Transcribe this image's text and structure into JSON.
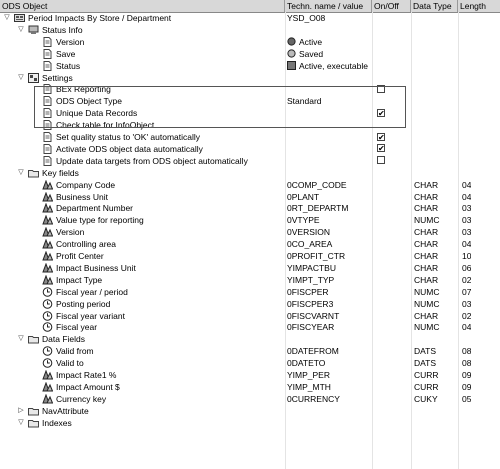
{
  "columns": [
    "ODS Object",
    "Techn. name / value",
    "On/Off",
    "Data Type",
    "Length"
  ],
  "rows": [
    {
      "level": 0,
      "tw": "down",
      "icon": "ods-object-icon",
      "label": "Period Impacts By Store / Department",
      "value": "YSD_O08"
    },
    {
      "level": 1,
      "tw": "down",
      "icon": "status-info-icon",
      "label": "Status Info"
    },
    {
      "level": 2,
      "icon": "doc-icon",
      "label": "Version",
      "value": "Active",
      "vicon": "active-dot-icon"
    },
    {
      "level": 2,
      "icon": "doc-icon",
      "label": "Save",
      "value": "Saved",
      "vicon": "saved-dot-icon"
    },
    {
      "level": 2,
      "icon": "doc-icon",
      "label": "Status",
      "value": "Active, executable",
      "vicon": "executable-square-icon"
    },
    {
      "level": 1,
      "tw": "down",
      "icon": "settings-icon",
      "label": "Settings"
    },
    {
      "level": 2,
      "icon": "doc-icon",
      "label": "BEx Reporting",
      "checkbox": "unchecked"
    },
    {
      "level": 2,
      "icon": "doc-icon",
      "label": "ODS Object Type",
      "value": "Standard"
    },
    {
      "level": 2,
      "icon": "doc-icon",
      "label": "Unique Data Records",
      "checkbox": "checked"
    },
    {
      "level": 2,
      "icon": "doc-icon",
      "label": "Check table for InfoObject"
    },
    {
      "level": 2,
      "icon": "doc-icon",
      "label": "Set quality status to 'OK' automatically",
      "checkbox": "checked"
    },
    {
      "level": 2,
      "icon": "doc-icon",
      "label": "Activate ODS object data automatically",
      "checkbox": "checked"
    },
    {
      "level": 2,
      "icon": "doc-icon",
      "label": "Update data targets from ODS object automatically",
      "checkbox": "unchecked"
    },
    {
      "level": 1,
      "tw": "down",
      "icon": "folder-icon",
      "label": "Key fields"
    },
    {
      "level": 2,
      "icon": "characteristic-icon",
      "label": "Company Code",
      "value": "0COMP_CODE",
      "dtype": "CHAR",
      "len": "04"
    },
    {
      "level": 2,
      "icon": "characteristic-icon",
      "label": "Business Unit",
      "value": "0PLANT",
      "dtype": "CHAR",
      "len": "04"
    },
    {
      "level": 2,
      "icon": "characteristic-icon",
      "label": "Department Number",
      "value": "0RT_DEPARTM",
      "dtype": "CHAR",
      "len": "03"
    },
    {
      "level": 2,
      "icon": "characteristic-icon",
      "label": "Value type for reporting",
      "value": "0VTYPE",
      "dtype": "NUMC",
      "len": "03"
    },
    {
      "level": 2,
      "icon": "characteristic-icon",
      "label": "Version",
      "value": "0VERSION",
      "dtype": "CHAR",
      "len": "03"
    },
    {
      "level": 2,
      "icon": "characteristic-icon",
      "label": "Controlling area",
      "value": "0CO_AREA",
      "dtype": "CHAR",
      "len": "04"
    },
    {
      "level": 2,
      "icon": "characteristic-icon",
      "label": "Profit Center",
      "value": "0PROFIT_CTR",
      "dtype": "CHAR",
      "len": "10"
    },
    {
      "level": 2,
      "icon": "characteristic-icon",
      "label": "Impact Business Unit",
      "value": "YIMPACTBU",
      "dtype": "CHAR",
      "len": "06"
    },
    {
      "level": 2,
      "icon": "characteristic-icon",
      "label": "Impact Type",
      "value": "YIMPT_TYP",
      "dtype": "CHAR",
      "len": "02"
    },
    {
      "level": 2,
      "icon": "clock-icon",
      "label": "Fiscal year / period",
      "value": "0FISCPER",
      "dtype": "NUMC",
      "len": "07"
    },
    {
      "level": 2,
      "icon": "clock-icon",
      "label": "Posting period",
      "value": "0FISCPER3",
      "dtype": "NUMC",
      "len": "03"
    },
    {
      "level": 2,
      "icon": "clock-icon",
      "label": "Fiscal year variant",
      "value": "0FISCVARNT",
      "dtype": "CHAR",
      "len": "02"
    },
    {
      "level": 2,
      "icon": "clock-icon",
      "label": "Fiscal year",
      "value": "0FISCYEAR",
      "dtype": "NUMC",
      "len": "04"
    },
    {
      "level": 1,
      "tw": "down",
      "icon": "folder-icon",
      "label": "Data Fields"
    },
    {
      "level": 2,
      "icon": "clock-icon",
      "label": "Valid from",
      "value": "0DATEFROM",
      "dtype": "DATS",
      "len": "08"
    },
    {
      "level": 2,
      "icon": "clock-icon",
      "label": "Valid to",
      "value": "0DATETO",
      "dtype": "DATS",
      "len": "08"
    },
    {
      "level": 2,
      "icon": "characteristic-icon",
      "label": "Impact Rate1 %",
      "value": "YIMP_PER",
      "dtype": "CURR",
      "len": "09"
    },
    {
      "level": 2,
      "icon": "characteristic-icon",
      "label": "Impact Amount $",
      "value": "YIMP_MTH",
      "dtype": "CURR",
      "len": "09"
    },
    {
      "level": 2,
      "icon": "characteristic-icon",
      "label": "Currency key",
      "value": "0CURRENCY",
      "dtype": "CUKY",
      "len": "05"
    },
    {
      "level": 1,
      "tw": "right",
      "icon": "folder-icon",
      "label": "NavAttribute"
    },
    {
      "level": 1,
      "tw": "down",
      "icon": "folder-icon",
      "label": "Indexes"
    }
  ]
}
